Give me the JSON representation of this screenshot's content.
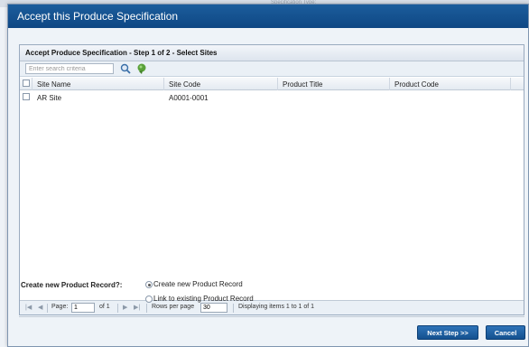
{
  "background": {
    "partial_text": "Specification Type:"
  },
  "dialog": {
    "title": "Accept this Produce Specification",
    "panel_title": "Accept Produce Specification - Step 1 of 2 - Select Sites",
    "search": {
      "placeholder": "Enter search criteria",
      "value": ""
    },
    "columns": [
      "Site Name",
      "Site Code",
      "Product Title",
      "Product Code"
    ],
    "rows": [
      {
        "site_name": "AR Site",
        "site_code": "A0001-0001",
        "product_title": "",
        "product_code": ""
      }
    ],
    "pager": {
      "page_label": "Page:",
      "page_value": "1",
      "of_label": "of 1",
      "rows_label": "Rows per page",
      "rows_value": "30",
      "display_text": "Displaying items 1 to 1 of 1"
    },
    "record": {
      "label": "Create new Product Record?:",
      "options": [
        "Create new Product Record",
        "Link to existing Product Record"
      ],
      "selected_index": 0
    },
    "buttons": {
      "next": "Next Step >>",
      "cancel": "Cancel"
    }
  },
  "colors": {
    "title_bar": "#1a5a98",
    "button": "#1c5fa2",
    "panel_border": "#99aabf"
  }
}
